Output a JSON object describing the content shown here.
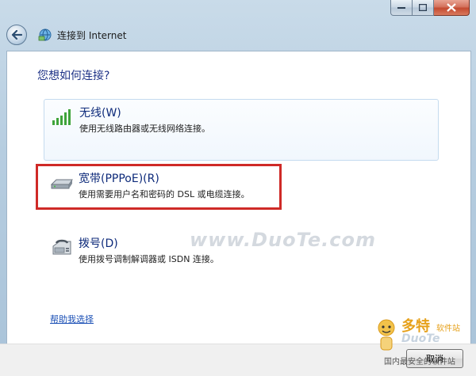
{
  "window": {
    "title": "连接到 Internet",
    "caption": {
      "minimize": "minimize",
      "maximize": "maximize",
      "close": "close"
    }
  },
  "nav": {
    "back_icon": "back-arrow-icon",
    "wizard_icon": "network-globe-icon"
  },
  "content": {
    "question": "您想如何连接?",
    "options": [
      {
        "title": "无线(W)",
        "description": "使用无线路由器或无线网络连接。",
        "icon": "signal-bars-icon"
      },
      {
        "title": "宽带(PPPoE)(R)",
        "description": "使用需要用户名和密码的 DSL 或电缆连接。",
        "icon": "modem-icon"
      },
      {
        "title": "拨号(D)",
        "description": "使用拨号调制解调器或 ISDN 连接。",
        "icon": "dialup-phone-icon"
      }
    ],
    "help_link": "帮助我选择",
    "watermark": "www.DuoTe.com"
  },
  "footer": {
    "cancel_label": "取消"
  },
  "branding": {
    "name": "多特",
    "sub": "软件站",
    "domain": "DuoTe",
    "tagline": "国内最安全的软件站"
  },
  "colors": {
    "highlight": "#cf2a27",
    "link": "#1a4fb5",
    "option_title": "#0d2a7a",
    "question": "#1e3287"
  }
}
